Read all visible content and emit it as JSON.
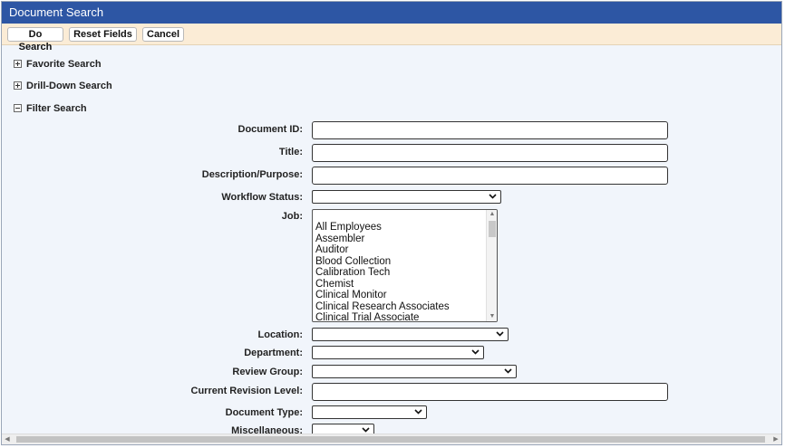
{
  "window": {
    "title": "Document Search"
  },
  "toolbar": {
    "do_search": "Do Search",
    "reset_fields": "Reset Fields",
    "cancel": "Cancel"
  },
  "sections": {
    "favorite": {
      "label": "Favorite Search",
      "state": "collapsed"
    },
    "drilldown": {
      "label": "Drill-Down Search",
      "state": "collapsed"
    },
    "filter": {
      "label": "Filter Search",
      "state": "expanded"
    }
  },
  "fields": {
    "document_id": {
      "label": "Document ID:",
      "value": ""
    },
    "title": {
      "label": "Title:",
      "value": ""
    },
    "description": {
      "label": "Description/Purpose:",
      "value": ""
    },
    "workflow_status": {
      "label": "Workflow Status:",
      "value": ""
    },
    "job": {
      "label": "Job:",
      "options": [
        "All Employees",
        "Assembler",
        "Auditor",
        "Blood Collection",
        "Calibration Tech",
        "Chemist",
        "Clinical Monitor",
        "Clinical Research Associates",
        "Clinical Trial Associate"
      ]
    },
    "location": {
      "label": "Location:",
      "value": ""
    },
    "department": {
      "label": "Department:",
      "value": ""
    },
    "review_group": {
      "label": "Review Group:",
      "value": ""
    },
    "current_revision": {
      "label": "Current Revision Level:",
      "value": ""
    },
    "document_type": {
      "label": "Document Type:",
      "value": ""
    },
    "miscellaneous": {
      "label": "Miscellaneous:",
      "value": ""
    }
  },
  "icons": {
    "expand": "plus-box-icon",
    "collapse": "minus-box-icon",
    "dropdown": "chevron-down-icon"
  },
  "colors": {
    "titlebar": "#2d56a4",
    "toolbar": "#fbecd6",
    "content": "#f1f5fb"
  }
}
